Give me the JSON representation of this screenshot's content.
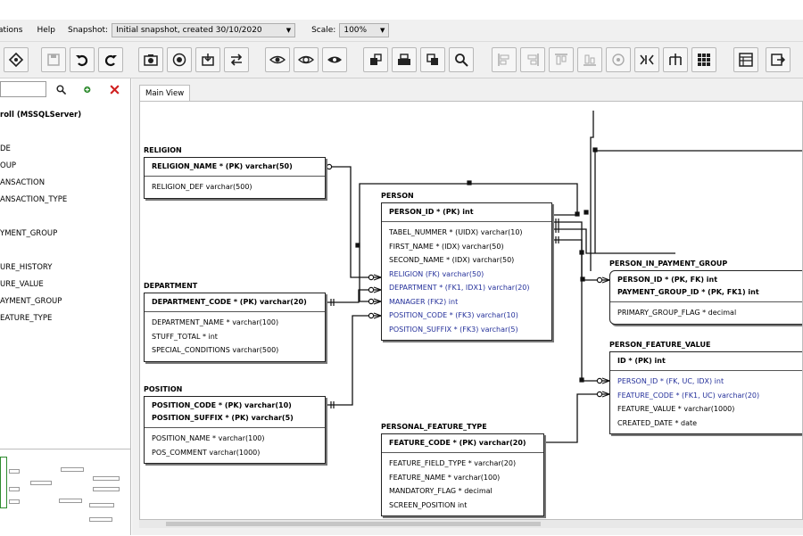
{
  "menu": {
    "items": [
      "ations",
      "Help"
    ],
    "snapshot_label": "Snapshot:",
    "snapshot_value": "Initial snapshot, created 30/10/2020",
    "scale_label": "Scale:",
    "scale_value": "100%"
  },
  "colors": {
    "fk_text": "#24309a",
    "delete_red": "#d02020",
    "entity_border": "#222222"
  },
  "toolbar_icons": [
    "diamond-icon",
    "save-icon",
    "undo-icon",
    "redo-icon",
    "camera-icon",
    "target-icon",
    "import-icon",
    "swap-icon",
    "eye-icon",
    "eye-settings-icon",
    "eye-hide-icon",
    "bring-front-icon",
    "send-back-icon",
    "refresh-icon",
    "search-icon",
    "align-left-icon",
    "align-right-icon",
    "align-top-icon",
    "align-bottom-icon",
    "align-center-icon",
    "distribute-icon",
    "tree-icon",
    "grid-icon",
    "table-icon",
    "export-icon"
  ],
  "left_panel": {
    "search_placeholder": "",
    "tree_items": [
      "roll (MSSQLServer)",
      "",
      "DE",
      "OUP",
      "ANSACTION",
      "ANSACTION_TYPE",
      "",
      "YMENT_GROUP",
      "",
      "URE_HISTORY",
      "URE_VALUE",
      "AYMENT_GROUP",
      "EATURE_TYPE"
    ]
  },
  "canvas": {
    "tab_label": "Main View"
  },
  "entities": {
    "religion": {
      "name": "RELIGION",
      "pk": [
        "RELIGION_NAME * (PK) varchar(50)"
      ],
      "attrs": [
        "RELIGION_DEF varchar(500)"
      ]
    },
    "department": {
      "name": "DEPARTMENT",
      "pk": [
        "DEPARTMENT_CODE * (PK) varchar(20)"
      ],
      "attrs": [
        "DEPARTMENT_NAME * varchar(100)",
        "STUFF_TOTAL * int",
        "SPECIAL_CONDITIONS varchar(500)"
      ]
    },
    "position": {
      "name": "POSITION",
      "pk": [
        "POSITION_CODE * (PK) varchar(10)",
        "POSITION_SUFFIX * (PK) varchar(5)"
      ],
      "attrs": [
        "POSITION_NAME * varchar(100)",
        "POS_COMMENT varchar(1000)"
      ]
    },
    "person": {
      "name": "PERSON",
      "pk": [
        "PERSON_ID * (PK) int"
      ],
      "attrs": [
        "TABEL_NUMMER * (UIDX) varchar(10)",
        "FIRST_NAME * (IDX) varchar(50)",
        "SECOND_NAME * (IDX) varchar(50)",
        "RELIGION (FK) varchar(50)",
        "DEPARTMENT * (FK1, IDX1) varchar(20)",
        "MANAGER (FK2) int",
        "POSITION_CODE * (FK3) varchar(10)",
        "POSITION_SUFFIX * (FK3) varchar(5)"
      ]
    },
    "person_in_payment_group": {
      "name": "PERSON_IN_PAYMENT_GROUP",
      "pk": [
        "PERSON_ID * (PK, FK) int",
        "PAYMENT_GROUP_ID * (PK, FK1) int"
      ],
      "attrs": [
        "PRIMARY_GROUP_FLAG * decimal"
      ]
    },
    "person_feature_value": {
      "name": "PERSON_FEATURE_VALUE",
      "pk": [
        "ID * (PK) int"
      ],
      "attrs": [
        "PERSON_ID * (FK, UC, IDX) int",
        "FEATURE_CODE * (FK1, UC) varchar(20)",
        "FEATURE_VALUE * varchar(1000)",
        "CREATED_DATE * date"
      ]
    },
    "personal_feature_type": {
      "name": "PERSONAL_FEATURE_TYPE",
      "pk": [
        "FEATURE_CODE * (PK) varchar(20)"
      ],
      "attrs": [
        "FEATURE_FIELD_TYPE * varchar(20)",
        "FEATURE_NAME * varchar(100)",
        "MANDATORY_FLAG * decimal",
        "SCREEN_POSITION int"
      ]
    }
  }
}
